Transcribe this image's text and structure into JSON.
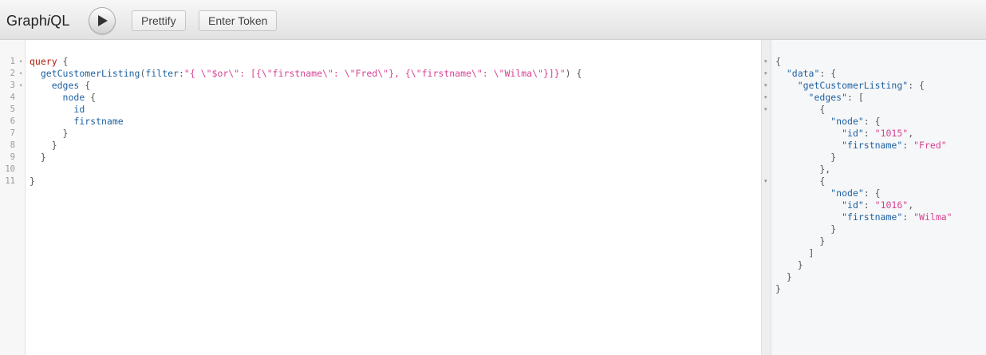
{
  "app": {
    "title_prefix": "Graph",
    "title_italic": "i",
    "title_suffix": "QL"
  },
  "toolbar": {
    "run_icon": "play-icon",
    "prettify_label": "Prettify",
    "token_label": "Enter Token"
  },
  "editor": {
    "line_numbers": [
      "1",
      "2",
      "3",
      "4",
      "5",
      "6",
      "7",
      "8",
      "9",
      "10",
      "11"
    ],
    "fold_markers": [
      "▾",
      "▾",
      "▾",
      "",
      "",
      "",
      "",
      "",
      "",
      "",
      ""
    ],
    "query": {
      "kw_query": "query",
      "brace_open": " {",
      "field_listing": "getCustomerListing",
      "paren_open": "(",
      "arg_filter": "filter",
      "colon": ":",
      "filter_value": "\"{ \\\"$or\\\": [{\\\"firstname\\\": \\\"Fred\\\"}, {\\\"firstname\\\": \\\"Wilma\\\"}]}\"",
      "paren_close_brace": ") {",
      "field_edges": "edges",
      "field_node": "node",
      "field_id": "id",
      "field_firstname": "firstname",
      "brace_close": "}"
    }
  },
  "result": {
    "key_data": "\"data\"",
    "key_listing": "\"getCustomerListing\"",
    "key_edges": "\"edges\"",
    "key_node": "\"node\"",
    "key_id": "\"id\"",
    "key_firstname": "\"firstname\"",
    "node1_id": "\"1015\"",
    "node1_firstname": "\"Fred\"",
    "node2_id": "\"1016\"",
    "node2_firstname": "\"Wilma\""
  }
}
